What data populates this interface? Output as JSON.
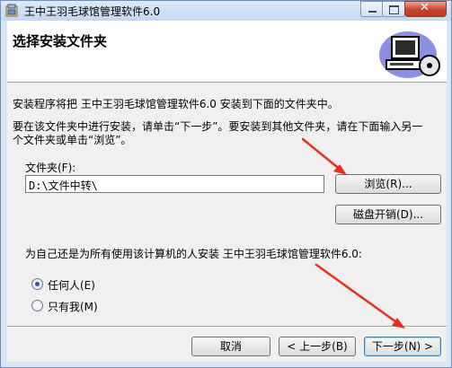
{
  "window": {
    "title": "王中王羽毛球馆管理软件6.0"
  },
  "header": {
    "title": "选择安装文件夹"
  },
  "body": {
    "intro": "安装程序将把 王中王羽毛球馆管理软件6.0 安装到下面的文件夹中。",
    "instructions_line1": "要在该文件夹中进行安装，请单击“下一步”。要安装到其他文件夹，请在下面输入另一",
    "instructions_line2": "个文件夹或单击“浏览”。"
  },
  "folder": {
    "label": "文件夹(F):",
    "value": "D:\\文件中转\\",
    "browse_label": "浏览(R)...",
    "disk_cost_label": "磁盘开销(D)..."
  },
  "install_for": {
    "question": "为自己还是为所有使用该计算机的人安装 王中王羽毛球馆管理软件6.0:",
    "options": [
      {
        "label": "任何人(E)",
        "selected": true
      },
      {
        "label": "只有我(M)",
        "selected": false
      }
    ]
  },
  "footer": {
    "cancel_label": "取消",
    "back_label": "< 上一步(B)",
    "next_label": "下一步(N) >"
  },
  "colors": {
    "annotation_arrow": "#e8301c",
    "title_bar": "#c4d7ee",
    "default_button_border": "#3c7fb1"
  },
  "icons": [
    "installer-icon",
    "computer-cd-icon",
    "minimize-icon",
    "maximize-icon",
    "close-icon"
  ]
}
